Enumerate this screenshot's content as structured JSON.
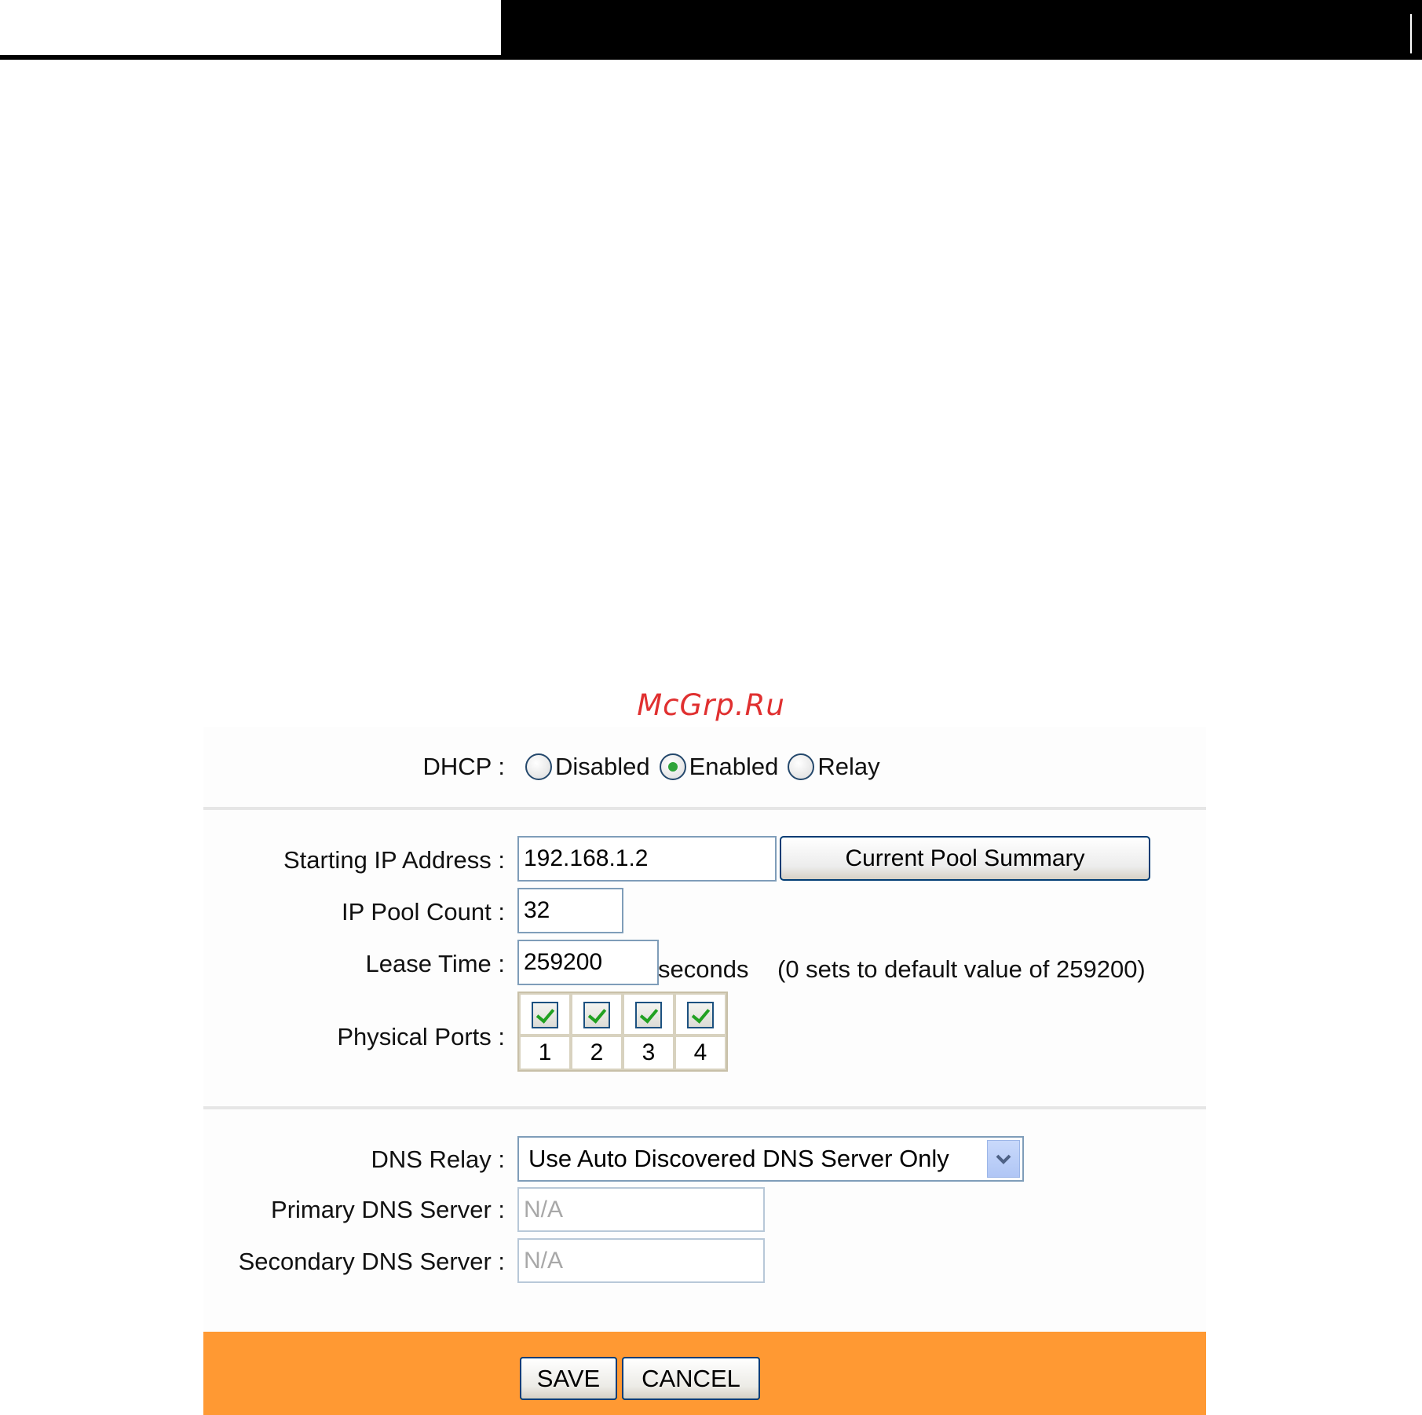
{
  "watermark": "McGrp.Ru",
  "dhcp": {
    "label": "DHCP :",
    "options": [
      {
        "label": "Disabled",
        "checked": false
      },
      {
        "label": "Enabled",
        "checked": true
      },
      {
        "label": "Relay",
        "checked": false
      }
    ]
  },
  "pool": {
    "start_label": "Starting IP Address :",
    "start_value": "192.168.1.2",
    "summary_button": "Current Pool Summary",
    "count_label": "IP Pool Count :",
    "count_value": "32",
    "lease_label": "Lease Time :",
    "lease_value": "259200",
    "lease_unit": "seconds",
    "lease_hint": "(0 sets to default value of 259200)",
    "ports_label": "Physical Ports :",
    "ports": [
      {
        "number": "1",
        "checked": true
      },
      {
        "number": "2",
        "checked": true
      },
      {
        "number": "3",
        "checked": true
      },
      {
        "number": "4",
        "checked": true
      }
    ]
  },
  "dns": {
    "relay_label": "DNS Relay :",
    "relay_value": "Use Auto Discovered DNS Server Only",
    "primary_label": "Primary DNS Server :",
    "primary_value": "N/A",
    "secondary_label": "Secondary DNS Server :",
    "secondary_value": "N/A"
  },
  "footer": {
    "save_label": "SAVE",
    "cancel_label": "CANCEL",
    "bg_color": "#ff9933"
  },
  "icons": {
    "dropdown": "chevron-down-icon",
    "checkbox": "checkmark-icon"
  }
}
